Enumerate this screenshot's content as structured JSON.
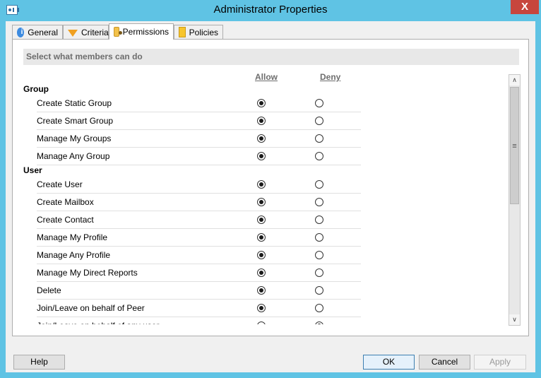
{
  "window": {
    "title": "Administrator Properties",
    "close_glyph": "X"
  },
  "tabs": [
    {
      "label": "General",
      "icon": "info-icon"
    },
    {
      "label": "Criteria",
      "icon": "funnel-icon"
    },
    {
      "label": "Permissions",
      "icon": "permissions-icon",
      "active": true
    },
    {
      "label": "Policies",
      "icon": "policy-icon"
    }
  ],
  "panel": {
    "section_header": "Select what members can do",
    "allow_header": "Allow",
    "deny_header": "Deny",
    "groups": [
      {
        "name": "Group",
        "permissions": [
          {
            "label": "Create Static Group",
            "value": "allow"
          },
          {
            "label": "Create Smart Group",
            "value": "allow"
          },
          {
            "label": "Manage My Groups",
            "value": "allow"
          },
          {
            "label": "Manage Any Group",
            "value": "allow"
          }
        ]
      },
      {
        "name": "User",
        "permissions": [
          {
            "label": "Create User",
            "value": "allow"
          },
          {
            "label": "Create Mailbox",
            "value": "allow"
          },
          {
            "label": "Create Contact",
            "value": "allow"
          },
          {
            "label": "Manage My Profile",
            "value": "allow"
          },
          {
            "label": "Manage Any Profile",
            "value": "allow"
          },
          {
            "label": "Manage My Direct Reports",
            "value": "allow"
          },
          {
            "label": "Delete",
            "value": "allow"
          },
          {
            "label": "Join/Leave on behalf of Peer",
            "value": "allow"
          },
          {
            "label": "Join/Leave on behalf of any user",
            "value": "deny"
          }
        ]
      }
    ],
    "scrollbar": {
      "up_glyph": "∧",
      "down_glyph": "∨",
      "thumb_glyph": "≡"
    }
  },
  "buttons": {
    "help": "Help",
    "ok": "OK",
    "cancel": "Cancel",
    "apply": "Apply"
  }
}
